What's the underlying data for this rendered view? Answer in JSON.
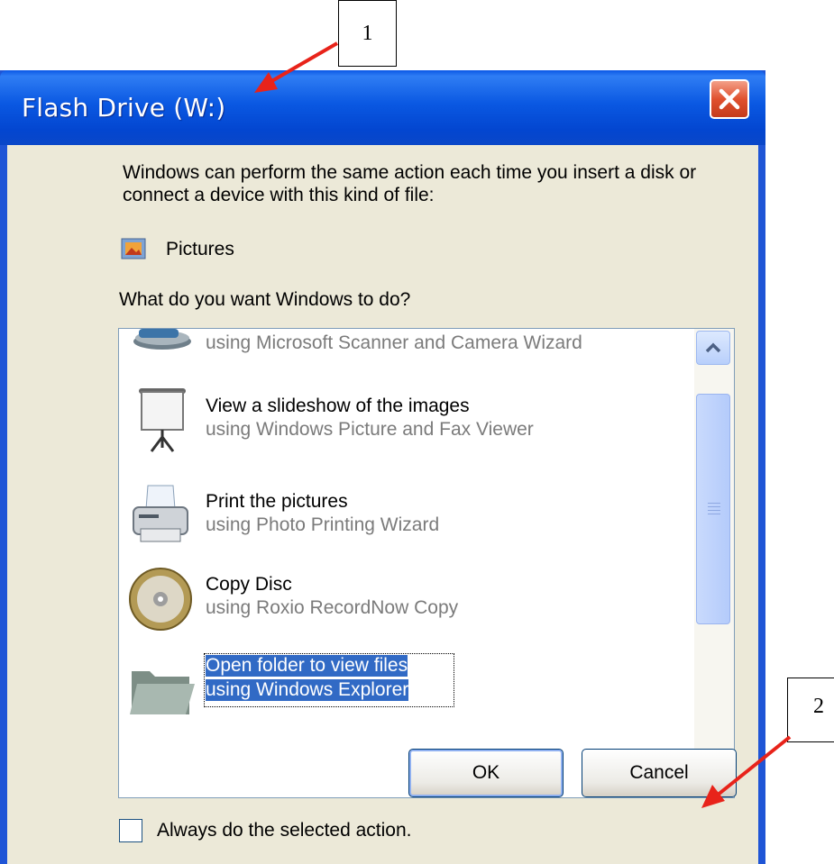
{
  "window": {
    "title": "Flash Drive (W:)",
    "close_icon": "close-icon"
  },
  "dialog": {
    "intro_text": "Windows can perform the same action each time you insert a disk or connect a device with this kind of file:",
    "content_type": "Pictures",
    "question": "What do you want Windows to do?",
    "actions": [
      {
        "line1": "",
        "line2": "using Microsoft Scanner and Camera Wizard",
        "icon": "camera-icon"
      },
      {
        "line1": "View a slideshow of the images",
        "line2": "using Windows Picture and Fax Viewer",
        "icon": "projector-screen-icon"
      },
      {
        "line1": "Print the pictures",
        "line2": "using Photo Printing Wizard",
        "icon": "printer-icon"
      },
      {
        "line1": "Copy Disc",
        "line2": "using Roxio RecordNow Copy",
        "icon": "disc-icon"
      },
      {
        "line1": "Open folder to view files",
        "line2": "using Windows Explorer",
        "icon": "folder-icon",
        "selected": true
      }
    ],
    "always_do_label": "Always do the selected action.",
    "always_do_checked": false,
    "ok_label": "OK",
    "cancel_label": "Cancel"
  },
  "callouts": [
    {
      "number": "1"
    },
    {
      "number": "2"
    }
  ],
  "colors": {
    "titlebar": "#0a58e2",
    "client_bg": "#ece9d8",
    "selection": "#316ac5",
    "arrow": "#e8231a"
  }
}
